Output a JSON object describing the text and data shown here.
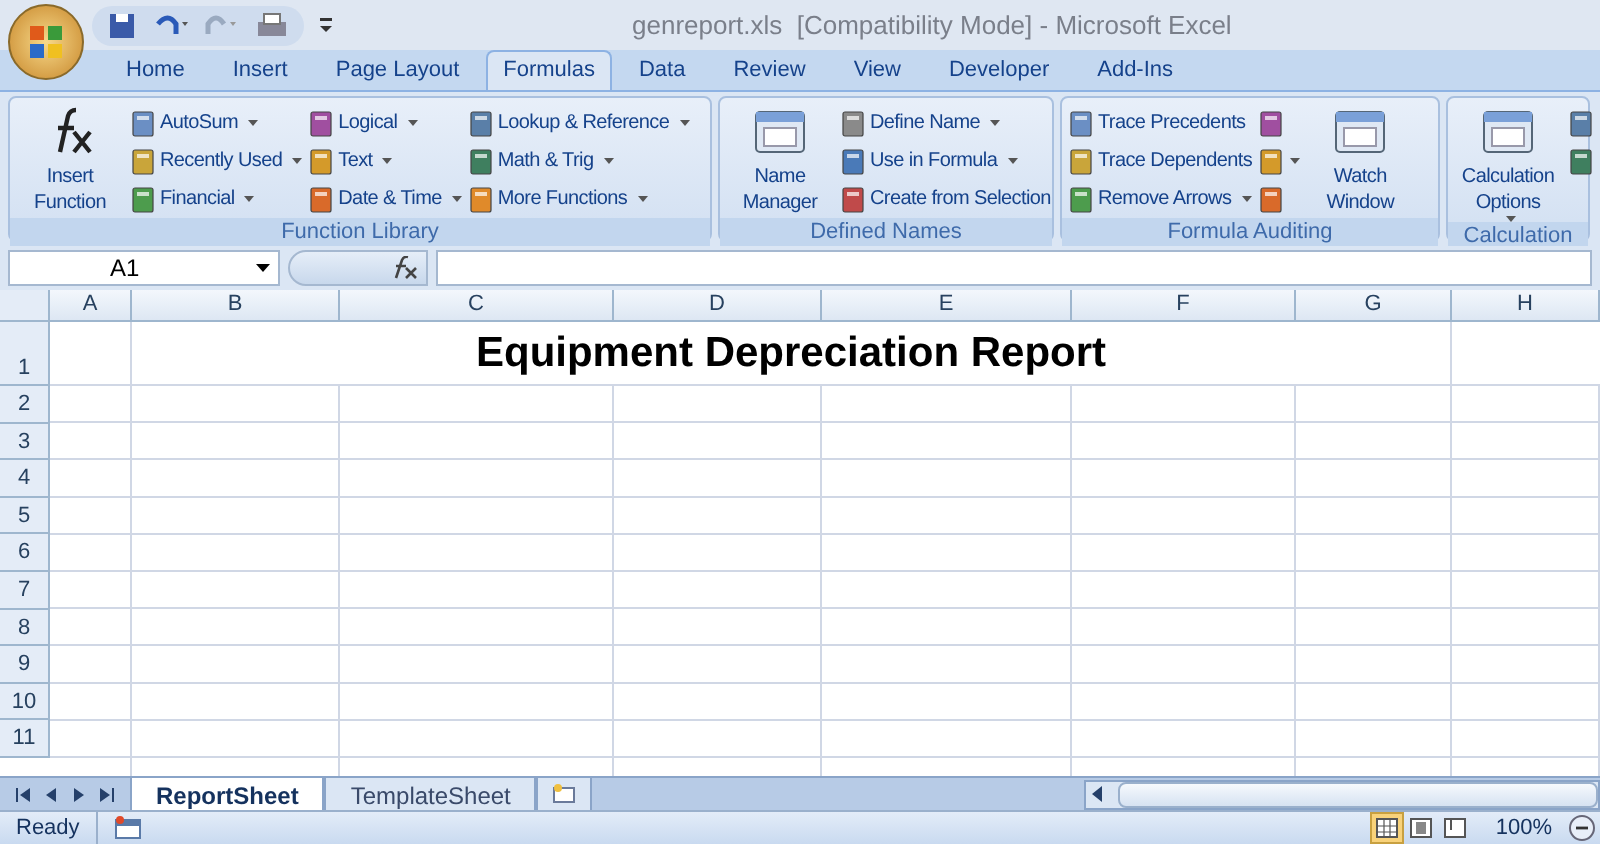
{
  "window": {
    "title": "genreport.xls  [Compatibility Mode] - Microsoft Excel"
  },
  "tabs": [
    {
      "label": "Home",
      "selected": false
    },
    {
      "label": "Insert",
      "selected": false
    },
    {
      "label": "Page Layout",
      "selected": false
    },
    {
      "label": "Formulas",
      "selected": true
    },
    {
      "label": "Data",
      "selected": false
    },
    {
      "label": "Review",
      "selected": false
    },
    {
      "label": "View",
      "selected": false
    },
    {
      "label": "Developer",
      "selected": false
    },
    {
      "label": "Add-Ins",
      "selected": false
    }
  ],
  "ribbon": [
    {
      "label": "Function Library",
      "big": [
        {
          "label": "Insert Function",
          "dropdown": false
        }
      ],
      "columns": [
        [
          {
            "label": "AutoSum",
            "dropdown": true
          },
          {
            "label": "Recently Used",
            "dropdown": true
          },
          {
            "label": "Financial",
            "dropdown": true
          }
        ],
        [
          {
            "label": "Logical",
            "dropdown": true
          },
          {
            "label": "Text",
            "dropdown": true
          },
          {
            "label": "Date & Time",
            "dropdown": true
          }
        ],
        [
          {
            "label": "Lookup & Reference",
            "dropdown": true
          },
          {
            "label": "Math & Trig",
            "dropdown": true
          },
          {
            "label": "More Functions",
            "dropdown": true
          }
        ]
      ]
    },
    {
      "label": "Defined Names",
      "big": [
        {
          "label": "Name Manager",
          "dropdown": false
        }
      ],
      "columns": [
        [
          {
            "label": "Define Name",
            "dropdown": true
          },
          {
            "label": "Use in Formula",
            "dropdown": true
          },
          {
            "label": "Create from Selection",
            "dropdown": false
          }
        ]
      ]
    },
    {
      "label": "Formula Auditing",
      "columns": [
        [
          {
            "label": "Trace Precedents",
            "dropdown": false
          },
          {
            "label": "Trace Dependents",
            "dropdown": false
          },
          {
            "label": "Remove Arrows",
            "dropdown": true
          }
        ],
        [
          {
            "dropdown": false
          },
          {
            "dropdown": true
          },
          {
            "dropdown": false
          }
        ]
      ],
      "trailing": [
        {
          "label": "Watch Window",
          "dropdown": false
        }
      ]
    },
    {
      "label": "Calculation",
      "big": [
        {
          "label": "Calculation Options",
          "dropdown": true
        }
      ],
      "columns": [
        [
          {
            "dropdown": false
          },
          {
            "dropdown": false
          }
        ]
      ]
    }
  ],
  "name_box": "A1",
  "columns": [
    "A",
    "B",
    "C",
    "D",
    "E",
    "F",
    "G",
    "H"
  ],
  "rows": [
    "1",
    "2",
    "3",
    "4",
    "5",
    "6",
    "7",
    "8",
    "9",
    "10",
    "11"
  ],
  "report_title": "Equipment Depreciation Report",
  "sheet_tabs": [
    {
      "label": "ReportSheet",
      "selected": true
    },
    {
      "label": "TemplateSheet",
      "selected": false
    }
  ],
  "status": "Ready",
  "views": [
    {
      "selected": true
    },
    {
      "selected": false
    },
    {
      "selected": false
    }
  ],
  "zoom": "100%"
}
